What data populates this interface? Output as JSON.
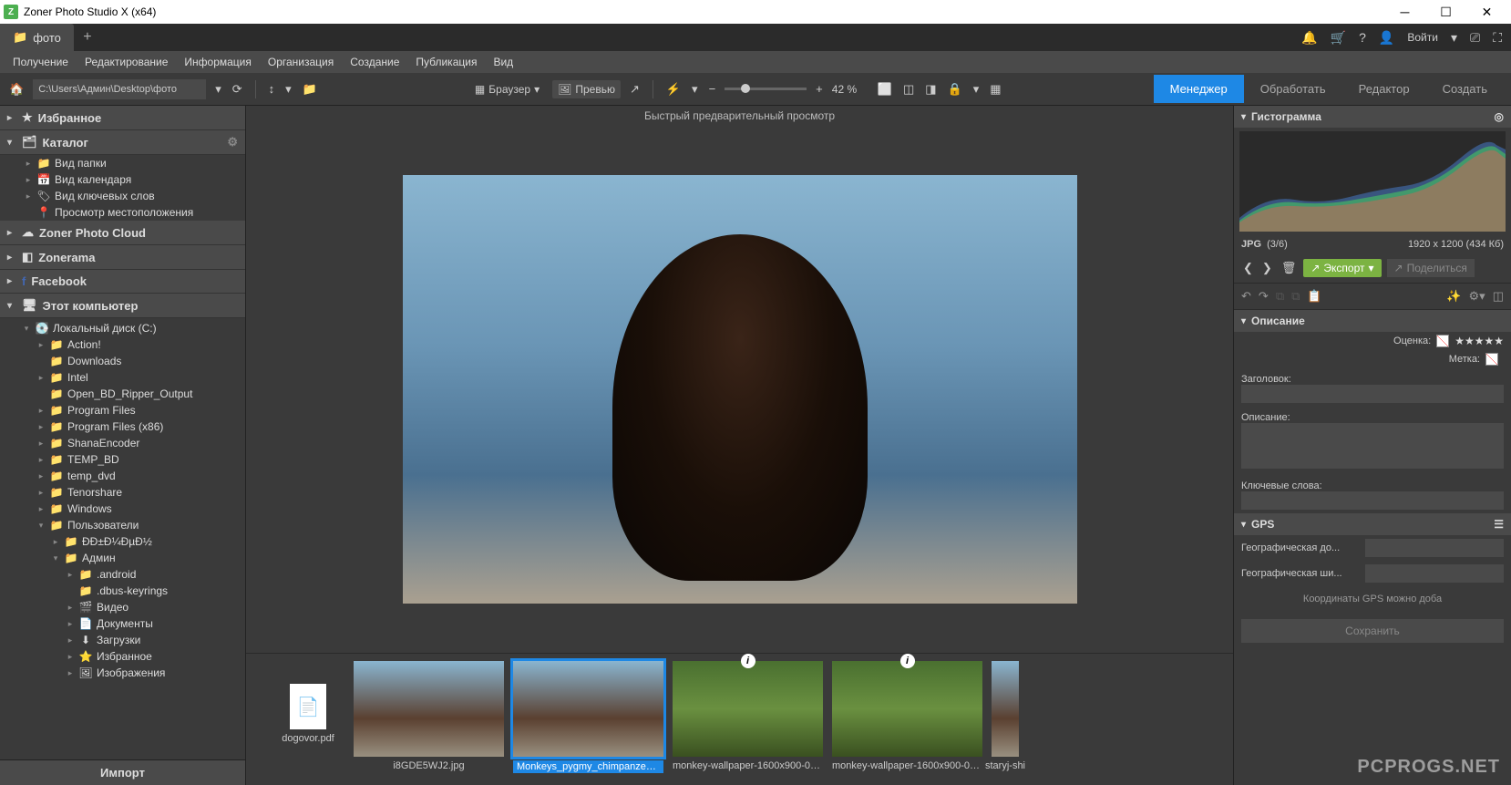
{
  "window": {
    "title": "Zoner Photo Studio X (x64)"
  },
  "tab": {
    "label": "фото"
  },
  "topright": {
    "login": "Войти"
  },
  "menu": [
    "Получение",
    "Редактирование",
    "Информация",
    "Организация",
    "Создание",
    "Публикация",
    "Вид"
  ],
  "path": "C:\\Users\\Админ\\Desktop\\фото",
  "viewmodes": {
    "browser": "Браузер",
    "preview": "Превью"
  },
  "zoom": "42 %",
  "modetabs": {
    "manager": "Менеджер",
    "develop": "Обработать",
    "editor": "Редактор",
    "create": "Создать"
  },
  "sidebar": {
    "favorites": "Избранное",
    "catalog": "Каталог",
    "catalog_items": [
      "Вид папки",
      "Вид календаря",
      "Вид ключевых слов",
      "Просмотр местоположения"
    ],
    "cloud": "Zoner Photo Cloud",
    "zonerama": "Zonerama",
    "facebook": "Facebook",
    "computer": "Этот компьютер",
    "drive": "Локальный диск (C:)",
    "folders": [
      "Action!",
      "Downloads",
      "Intel",
      "Open_BD_Ripper_Output",
      "Program Files",
      "Program Files (x86)",
      "ShanaEncoder",
      "TEMP_BD",
      "temp_dvd",
      "Tenorshare",
      "Windows"
    ],
    "users": "Пользователи",
    "user_sub": [
      "ĐĐ±Đ¼ĐµĐ½",
      "Админ"
    ],
    "admin_sub": [
      ".android",
      ".dbus-keyrings",
      "Видео",
      "Документы",
      "Загрузки",
      "Избранное",
      "Изображения"
    ],
    "import": "Импорт"
  },
  "preview_label": "Быстрый предварительный просмотр",
  "thumbs": [
    {
      "name": "dogovor.pdf",
      "type": "pdf"
    },
    {
      "name": "i8GDE5WJ2.jpg",
      "type": "chimp"
    },
    {
      "name": "Monkeys_pygmy_chimpanzee_4...",
      "type": "chimp",
      "selected": true
    },
    {
      "name": "monkey-wallpaper-1600x900-00...",
      "type": "green",
      "info": true
    },
    {
      "name": "monkey-wallpaper-1600x900-00...",
      "type": "green",
      "info": true
    },
    {
      "name": "staryj-shi",
      "type": "partial"
    }
  ],
  "right": {
    "histogram": "Гистограмма",
    "format": "JPG",
    "index": "(3/6)",
    "dims": "1920 x 1200 (434 Кб)",
    "export": "Экспорт",
    "share": "Поделиться",
    "description": "Описание",
    "rating": "Оценка:",
    "label": "Метка:",
    "title_field": "Заголовок:",
    "desc_field": "Описание:",
    "keywords": "Ключевые слова:",
    "gps": "GPS",
    "geo_long": "Географическая до...",
    "geo_lat": "Географическая ши...",
    "gps_note": "Координаты GPS можно доба",
    "save": "Сохранить"
  },
  "watermark": "PCPROGS.NET"
}
